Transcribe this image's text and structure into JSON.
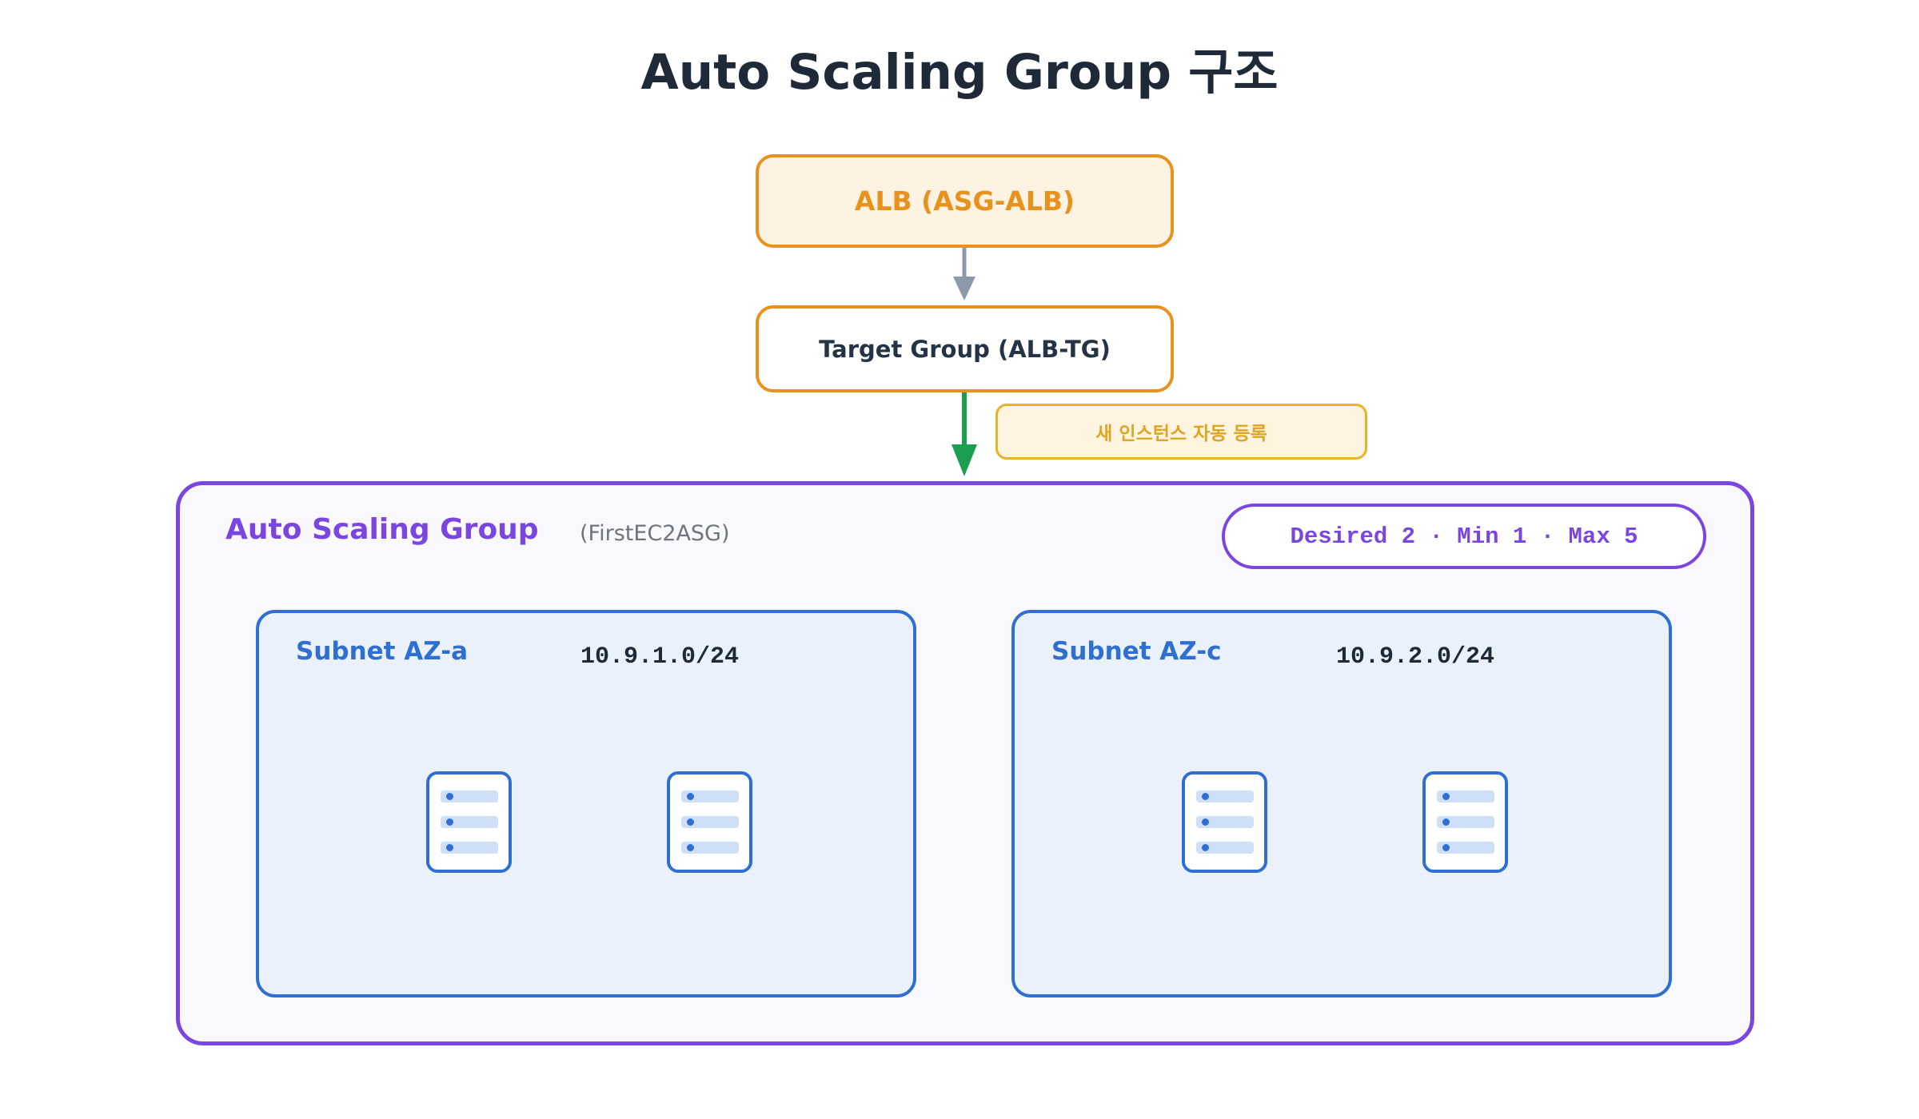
{
  "title": "Auto Scaling Group 구조",
  "alb": {
    "label": "ALB (ASG-ALB)"
  },
  "target_group": {
    "label": "Target Group (ALB-TG)"
  },
  "note": {
    "label": "새 인스턴스 자동 등록"
  },
  "asg": {
    "label": "Auto Scaling Group",
    "name": "(FirstEC2ASG)",
    "capacity": "Desired 2 · Min 1 · Max 5"
  },
  "subnets": [
    {
      "label": "Subnet AZ-a",
      "cidr": "10.9.1.0/24",
      "instances": 2
    },
    {
      "label": "Subnet AZ-c",
      "cidr": "10.9.2.0/24",
      "instances": 2
    }
  ],
  "colors": {
    "alb_border": "#e8911c",
    "alb_fill": "#fef3e2",
    "asg_accent": "#7b45e0",
    "subnet_accent": "#2f6fd1",
    "arrow_gray": "#8d99a8",
    "arrow_green": "#1a9e50",
    "note_accent": "#e0a422"
  },
  "icons": [
    "server-icon"
  ]
}
